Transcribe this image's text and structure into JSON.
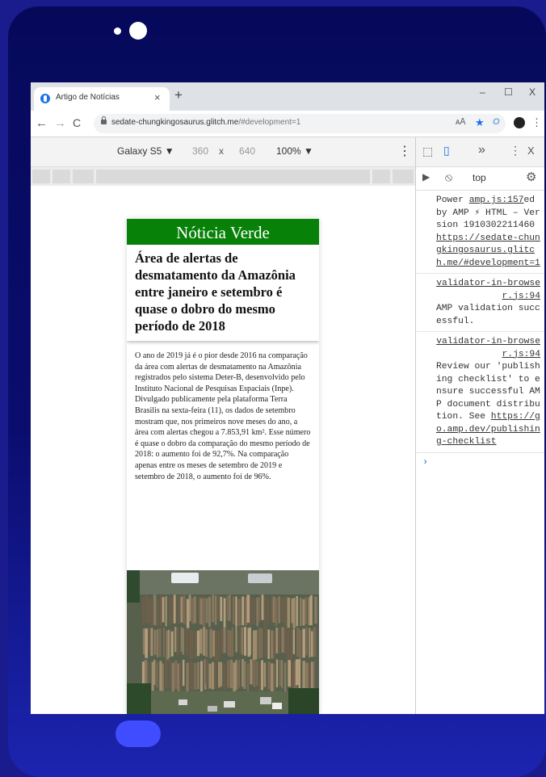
{
  "browser": {
    "tab_title": "Artigo de Notícias",
    "tab_close": "×",
    "new_tab": "+",
    "minimize": "–",
    "maximize": "☐",
    "close": "X",
    "url_host": "sedate-chungkingosaurus.glitch.me",
    "url_path": "/#development=1"
  },
  "device_toolbar": {
    "device": "Galaxy S5 ▼",
    "width": "360",
    "times": "x",
    "height": "640",
    "zoom": "100% ▼",
    "menu": "⋮"
  },
  "article": {
    "brand": "Nóticia Verde",
    "headline": "Área de alertas de desmatamento da Amazônia entre janeiro e setembro é quase o dobro do mesmo período de 2018",
    "body": "O ano de 2019 já é o pior desde 2016 na comparação da área com alertas de desmatamento na Amazônia registrados pelo sistema Deter-B, desenvolvido pelo Instituto Nacional de Pesquisas Espaciais (Inpe). Divulgado publicamente pela plataforma Terra Brasilis na sexta-feira (11), os dados de setembro mostram que, nos primeiros nove meses do ano, a área com alertas chegou a 7.853,91 km². Esse número é quase o dobro da comparação do mesmo período de 2018: o aumento foi de 92,7%. Na comparação apenas entre os meses de setembro de 2019 e setembro de 2018, o aumento foi de 96%."
  },
  "devtools": {
    "more_tabs": "»",
    "menu": "⋮",
    "close": "X",
    "context": "top",
    "messages": [
      {
        "pre": "Power ",
        "src": "amp.js:157",
        "text": "ed by AMP ⚡ HTML – Version 1910302211460 ",
        "link": "https://sedate-chungkingosaurus.glitch.me/#development=1"
      },
      {
        "src": "validator-in-browser.js:94",
        "text": "AMP validation successful."
      },
      {
        "src": "validator-in-browser.js:94",
        "text": "Review our 'publishing checklist' to ensure successful AMP document distribution. See ",
        "link": "https://go.amp.dev/publishing-checklist"
      }
    ],
    "prompt": "›"
  }
}
